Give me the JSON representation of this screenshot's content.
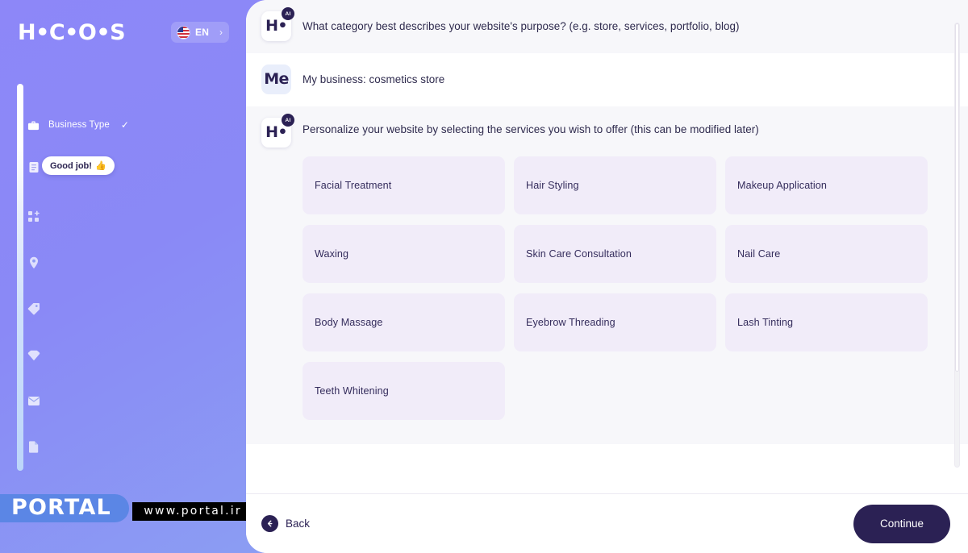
{
  "brand": {
    "logo_text": "H•C•O•S",
    "logo_icon": "hocoos-logo-icon"
  },
  "language_selector": {
    "code": "EN",
    "chevron": "›",
    "flag_icon": "us-flag-icon"
  },
  "sidebar": {
    "items": [
      {
        "label": "Business Type",
        "icon": "briefcase-icon",
        "check": "✓",
        "completed": true
      },
      {
        "label": "",
        "icon": "clipboard-icon",
        "check": "",
        "completed": false
      },
      {
        "label": "",
        "icon": "grid-plus-icon",
        "check": "",
        "completed": false
      },
      {
        "label": "",
        "icon": "location-pin-icon",
        "check": "",
        "completed": false
      },
      {
        "label": "",
        "icon": "tag-icon",
        "check": "",
        "completed": false
      },
      {
        "label": "",
        "icon": "diamond-icon",
        "check": "",
        "completed": false
      },
      {
        "label": "",
        "icon": "envelope-icon",
        "check": "",
        "completed": false
      },
      {
        "label": "",
        "icon": "document-icon",
        "check": "",
        "completed": false
      }
    ],
    "tooltip": {
      "text": "Good job!",
      "emoji": "👍"
    }
  },
  "watermark": {
    "title": "PORTAL",
    "url": "www.portal.ir"
  },
  "chat": {
    "messages": [
      {
        "sender": "ai",
        "avatar_mark": "H•",
        "badge": "AI",
        "text": "What category best describes your website's purpose? (e.g. store, services, portfolio, blog)"
      },
      {
        "sender": "me",
        "avatar_mark": "Me",
        "badge": "",
        "text": "My business: cosmetics store"
      },
      {
        "sender": "ai",
        "avatar_mark": "H•",
        "badge": "AI",
        "text": "Personalize your website by selecting the services you wish to offer (this can be modified later)"
      }
    ]
  },
  "services": [
    {
      "label": "Facial Treatment"
    },
    {
      "label": "Hair Styling"
    },
    {
      "label": "Makeup Application"
    },
    {
      "label": "Waxing"
    },
    {
      "label": "Skin Care Consultation"
    },
    {
      "label": "Nail Care"
    },
    {
      "label": "Body Massage"
    },
    {
      "label": "Eyebrow Threading"
    },
    {
      "label": "Lash Tinting"
    },
    {
      "label": "Teeth Whitening"
    }
  ],
  "footer": {
    "back_label": "Back",
    "back_icon": "arrow-left-icon",
    "continue_label": "Continue"
  },
  "colors": {
    "brand_dark": "#2b2154",
    "card_bg": "#f1ecf9",
    "ai_row_bg": "#f7f7fa",
    "sidebar_gradient_start": "#8d87f8",
    "sidebar_gradient_end": "#93b6f0",
    "watermark_blue": "#5b86e5"
  }
}
